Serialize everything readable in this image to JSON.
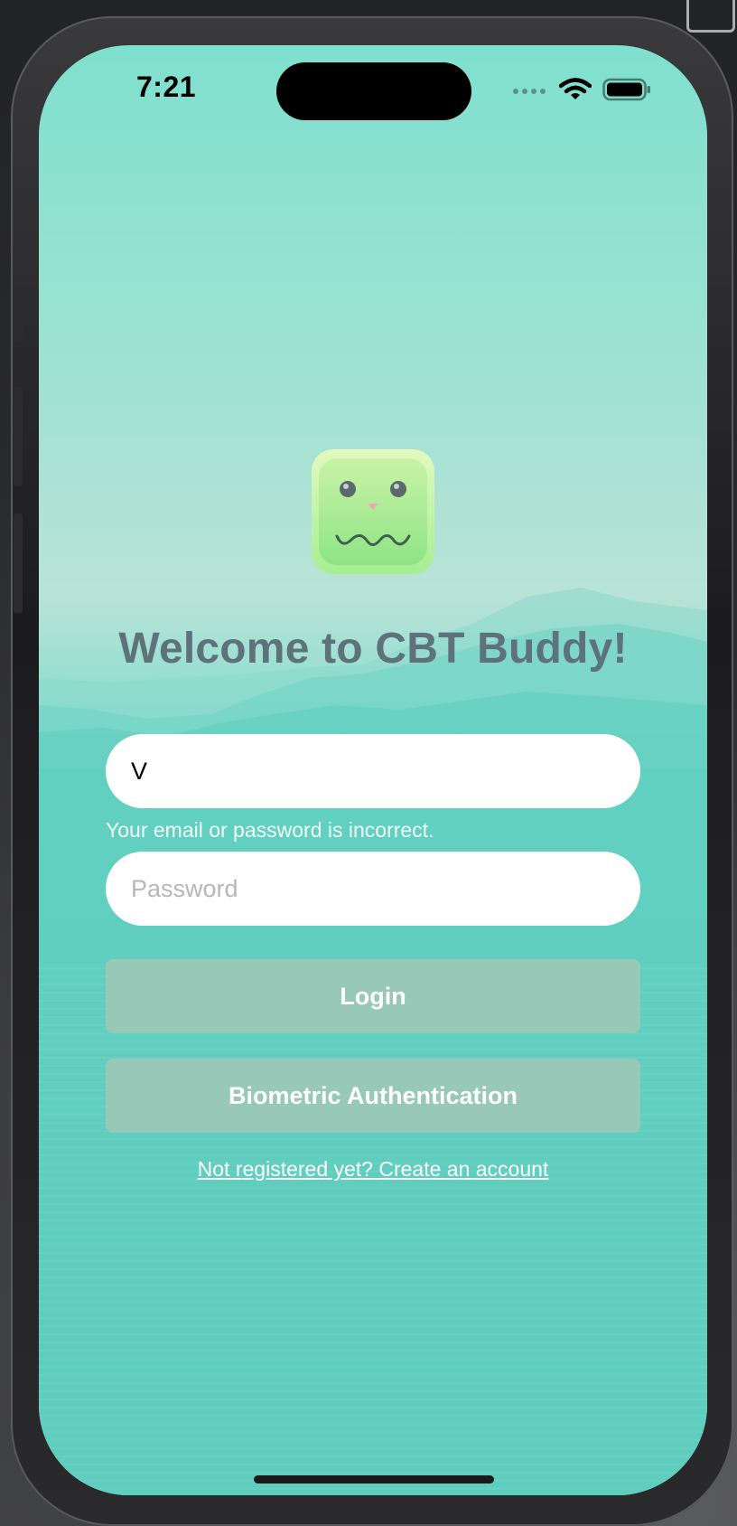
{
  "status_bar": {
    "time": "7:21",
    "icons": [
      "cellular-signal-icon",
      "wifi-icon",
      "battery-icon"
    ]
  },
  "login": {
    "logo_icon": "cbt-buddy-logo",
    "title": "Welcome to CBT Buddy!",
    "email_value": "V",
    "error_message": "Your email or password is incorrect.",
    "password_placeholder": "Password",
    "login_label": "Login",
    "biometric_label": "Biometric Authentication",
    "register_link": "Not registered yet? Create an account"
  },
  "colors": {
    "title": "#5e727b",
    "button_bg": "#97c8b8",
    "background_top": "#7fe0ce",
    "background_bottom": "#4fb3a5"
  }
}
